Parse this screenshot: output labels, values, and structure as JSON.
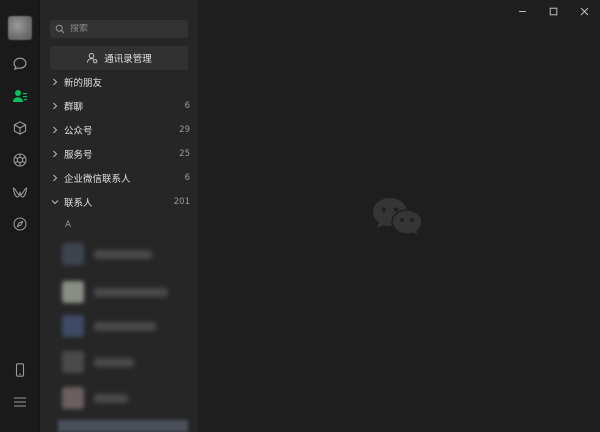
{
  "search": {
    "placeholder": "搜索"
  },
  "manage_button": {
    "label": "通讯录管理"
  },
  "groups": [
    {
      "label": "新的朋友",
      "count": "",
      "expanded": false
    },
    {
      "label": "群聊",
      "count": "6",
      "expanded": false
    },
    {
      "label": "公众号",
      "count": "29",
      "expanded": false
    },
    {
      "label": "服务号",
      "count": "25",
      "expanded": false
    },
    {
      "label": "企业微信联系人",
      "count": "6",
      "expanded": false
    },
    {
      "label": "联系人",
      "count": "201",
      "expanded": true
    }
  ],
  "index_letter": "A",
  "rail_icons": [
    "avatar",
    "chat-icon",
    "contacts-icon",
    "cube-icon",
    "moments-icon",
    "channels-icon",
    "discover-icon",
    "phone-icon",
    "menu-icon"
  ],
  "colors": {
    "accent": "#07c160",
    "rail_bg": "#1a1a1a",
    "list_bg": "#262626",
    "main_bg": "#1e1e1e"
  }
}
